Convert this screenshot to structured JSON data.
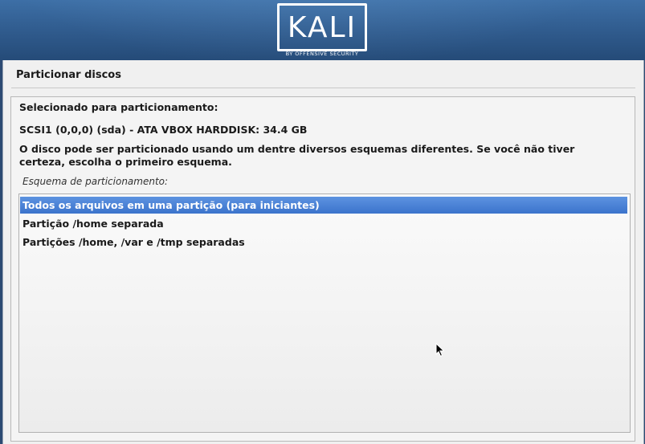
{
  "header": {
    "logo_text": "KALI",
    "logo_subtitle": "BY OFFENSIVE SECURITY"
  },
  "page": {
    "title": "Particionar discos"
  },
  "content": {
    "selected_heading": "Selecionado para particionamento:",
    "disk_info": "SCSI1 (0,0,0) (sda) - ATA VBOX HARDDISK: 34.4 GB",
    "prompt": "O disco pode ser particionado usando um dentre diversos esquemas diferentes. Se você não tiver certeza, escolha o primeiro esquema.",
    "schema_label": "Esquema de particionamento:",
    "options": [
      {
        "label": "Todos os arquivos em uma partição (para iniciantes)",
        "selected": true
      },
      {
        "label": "Partição /home separada",
        "selected": false
      },
      {
        "label": "Partições /home, /var e /tmp separadas",
        "selected": false
      }
    ]
  },
  "colors": {
    "header_bg": "#2f5a8c",
    "selection_bg": "#3b73cc",
    "panel_bg": "#f0f0f0"
  }
}
